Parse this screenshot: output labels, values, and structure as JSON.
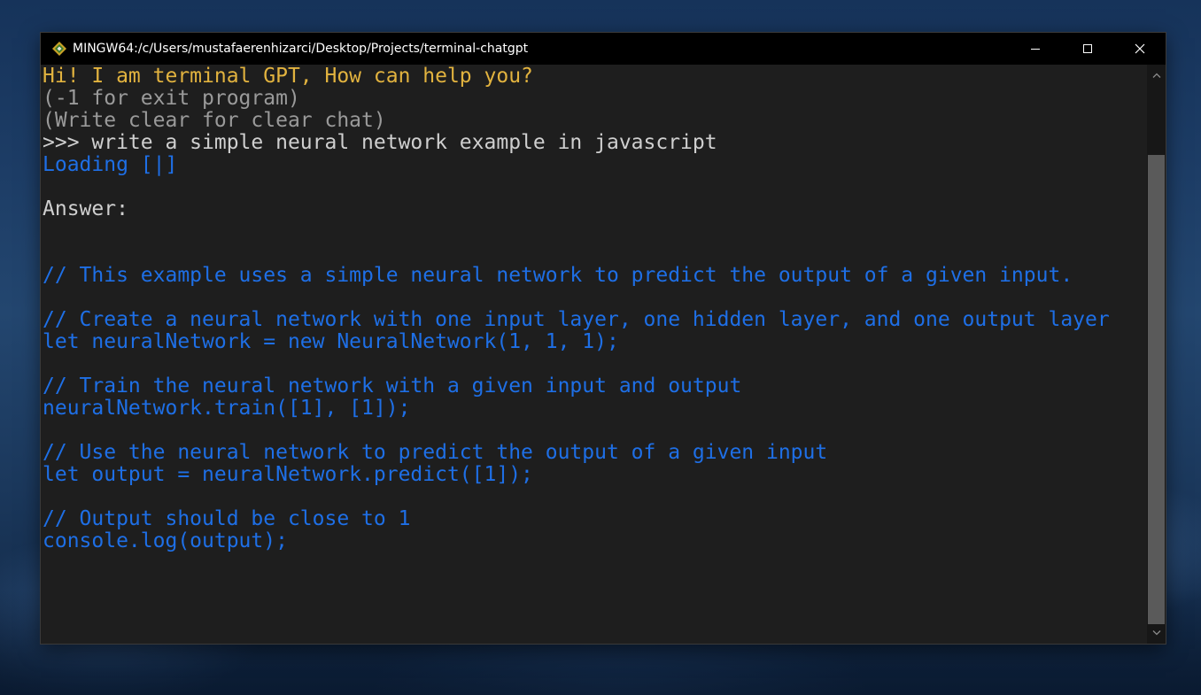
{
  "window": {
    "title": "MINGW64:/c/Users/mustafaerenhizarci/Desktop/Projects/terminal-chatgpt",
    "controls": {
      "minimize_icon": "minimize-icon",
      "maximize_icon": "maximize-icon",
      "close_icon": "close-icon"
    }
  },
  "terminal": {
    "lines": [
      {
        "text": "Hi! I am terminal GPT, How can help you?",
        "color": "#e2b33f"
      },
      {
        "text": "(-1 for exit program)",
        "color": "#9a9a9a"
      },
      {
        "text": "(Write clear for clear chat)",
        "color": "#9a9a9a"
      },
      {
        "text": ">>> write a simple neural network example in javascript",
        "color": "#cfcfcf"
      },
      {
        "text": "Loading [|]",
        "color": "#1e6fe6"
      },
      {
        "text": "",
        "color": "#cfcfcf"
      },
      {
        "text": "Answer:",
        "color": "#cfcfcf"
      },
      {
        "text": "",
        "color": "#cfcfcf"
      },
      {
        "text": "",
        "color": "#cfcfcf"
      },
      {
        "text": "// This example uses a simple neural network to predict the output of a given input.",
        "color": "#1e6fe6"
      },
      {
        "text": "",
        "color": "#1e6fe6"
      },
      {
        "text": "// Create a neural network with one input layer, one hidden layer, and one output layer",
        "color": "#1e6fe6"
      },
      {
        "text": "let neuralNetwork = new NeuralNetwork(1, 1, 1);",
        "color": "#1e6fe6"
      },
      {
        "text": "",
        "color": "#1e6fe6"
      },
      {
        "text": "// Train the neural network with a given input and output",
        "color": "#1e6fe6"
      },
      {
        "text": "neuralNetwork.train([1], [1]);",
        "color": "#1e6fe6"
      },
      {
        "text": "",
        "color": "#1e6fe6"
      },
      {
        "text": "// Use the neural network to predict the output of a given input",
        "color": "#1e6fe6"
      },
      {
        "text": "let output = neuralNetwork.predict([1]);",
        "color": "#1e6fe6"
      },
      {
        "text": "",
        "color": "#1e6fe6"
      },
      {
        "text": "// Output should be close to 1",
        "color": "#1e6fe6"
      },
      {
        "text": "console.log(output);",
        "color": "#1e6fe6"
      }
    ],
    "prompt": ">>>"
  },
  "colors": {
    "greeting": "#e2b33f",
    "hint": "#9a9a9a",
    "input": "#cfcfcf",
    "answer_code": "#1e6fe6",
    "background": "#1e1e1e"
  }
}
